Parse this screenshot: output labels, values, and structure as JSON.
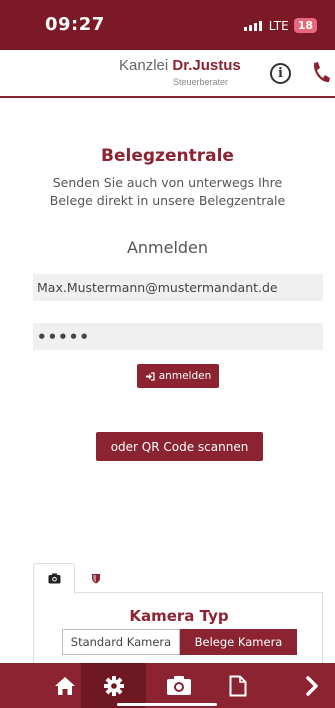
{
  "status_bar": {
    "time": "09:27",
    "network": "LTE",
    "battery": "18"
  },
  "header": {
    "logo_prefix": "Kanzlei ",
    "logo_name": "Dr.Justus",
    "logo_subtitle": "Steuerberater",
    "info_icon": "info-icon",
    "phone_icon": "phone-icon"
  },
  "main": {
    "title": "Belegzentrale",
    "subtitle": "Senden Sie auch von unterwegs Ihre Belege direkt in unsere Belegzentrale",
    "login_heading": "Anmelden",
    "email_value": "Max.Mustermann@mustermandant.de",
    "password_value": "•••••",
    "login_button": "anmelden",
    "qr_button": "oder QR Code scannen"
  },
  "tabs": [
    {
      "icon": "camera-icon",
      "active": true
    },
    {
      "icon": "shield-icon",
      "active": false
    }
  ],
  "camera_panel": {
    "title": "Kamera Typ",
    "options": [
      "Standard Kamera",
      "Belege Kamera"
    ],
    "selected": "Belege Kamera"
  },
  "bottom_nav": {
    "items": [
      "home-icon",
      "gear-icon",
      "camera-icon",
      "document-icon",
      "chevron-right-icon"
    ],
    "active": "gear-icon"
  },
  "colors": {
    "brand": "#8c2331",
    "status_bar": "#7b1a26",
    "nav_active": "#6e1822",
    "field_bg": "#f0f0f0"
  }
}
